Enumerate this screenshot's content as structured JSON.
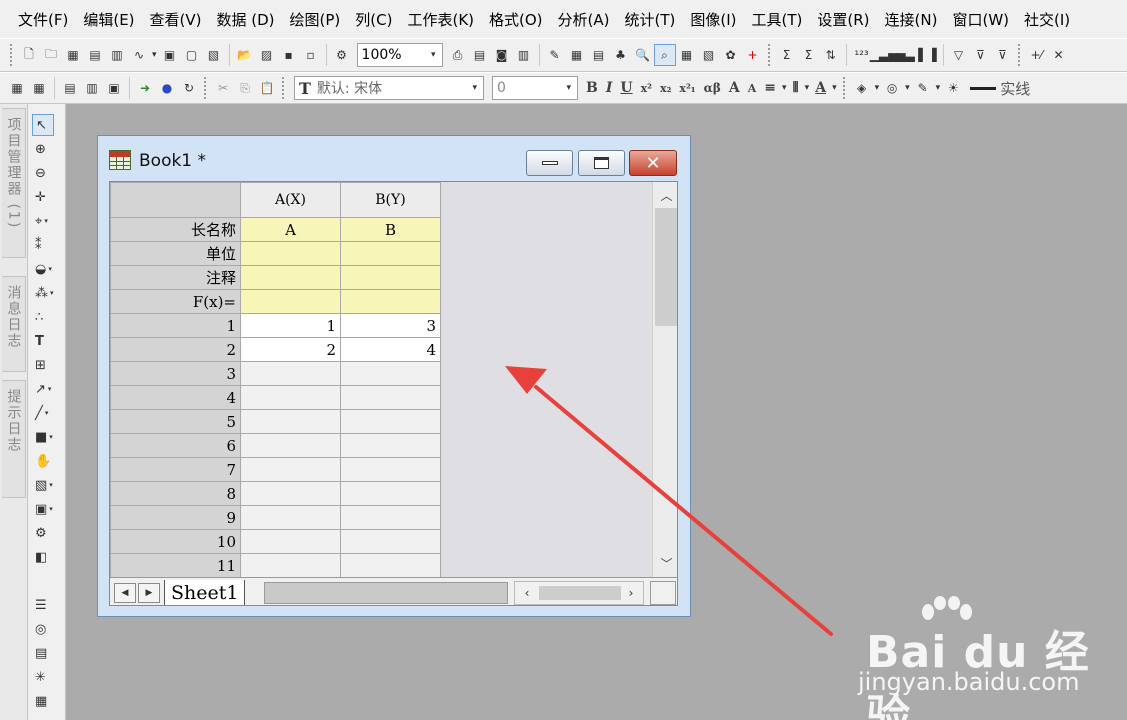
{
  "menubar": {
    "items": [
      "文件(F)",
      "编辑(E)",
      "查看(V)",
      "数据 (D)",
      "绘图(P)",
      "列(C)",
      "工作表(K)",
      "格式(O)",
      "分析(A)",
      "统计(T)",
      "图像(I)",
      "工具(T)",
      "设置(R)",
      "连接(N)",
      "窗口(W)",
      "社交(I)"
    ]
  },
  "toolbar": {
    "zoom_value": "100%",
    "font_name": "默认: 宋体",
    "font_size": "0",
    "line_style": "实线"
  },
  "dock_tabs": [
    "项目管理器 (1)",
    "消息日志",
    "提示日志"
  ],
  "workbook": {
    "title": "Book1 *",
    "columns": [
      "A(X)",
      "B(Y)"
    ],
    "meta_rows": [
      {
        "label": "长名称",
        "values": [
          "A",
          "B"
        ]
      },
      {
        "label": "单位",
        "values": [
          "",
          ""
        ]
      },
      {
        "label": "注释",
        "values": [
          "",
          ""
        ]
      },
      {
        "label": "F(x)=",
        "values": [
          "",
          ""
        ]
      }
    ],
    "data_rows": [
      {
        "label": "1",
        "values": [
          "1",
          "3"
        ]
      },
      {
        "label": "2",
        "values": [
          "2",
          "4"
        ]
      },
      {
        "label": "3",
        "values": [
          "",
          ""
        ]
      },
      {
        "label": "4",
        "values": [
          "",
          ""
        ]
      },
      {
        "label": "5",
        "values": [
          "",
          ""
        ]
      },
      {
        "label": "6",
        "values": [
          "",
          ""
        ]
      },
      {
        "label": "7",
        "values": [
          "",
          ""
        ]
      },
      {
        "label": "8",
        "values": [
          "",
          ""
        ]
      },
      {
        "label": "9",
        "values": [
          "",
          ""
        ]
      },
      {
        "label": "10",
        "values": [
          "",
          ""
        ]
      },
      {
        "label": "11",
        "values": [
          "",
          ""
        ]
      }
    ],
    "sheet_tab": "Sheet1"
  },
  "watermark": {
    "brand": "Bai du 经验",
    "url": "jingyan.baidu.com"
  },
  "colors": {
    "meta_row_bg": "#f8f5b8",
    "annotation_arrow": "#e8403a",
    "close_button": "#c8432e"
  }
}
